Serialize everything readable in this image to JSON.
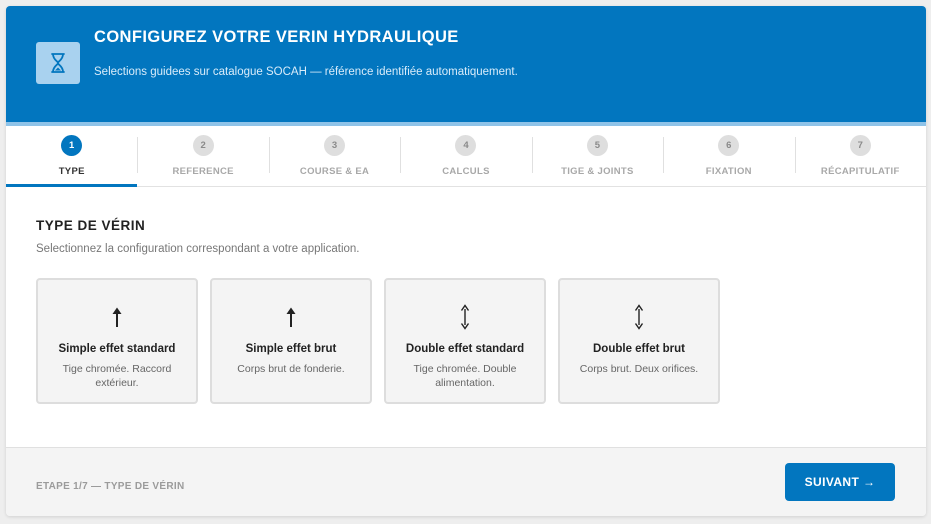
{
  "header": {
    "title": "CONFIGUREZ VOTRE VERIN HYDRAULIQUE",
    "subtitle": "Selections guidees sur catalogue SOCAH — référence identifiée automatiquement.",
    "icon": "hourglass-icon"
  },
  "steps": [
    {
      "num": "1",
      "label": "TYPE",
      "active": true
    },
    {
      "num": "2",
      "label": "REFERENCE",
      "active": false
    },
    {
      "num": "3",
      "label": "COURSE & EA",
      "active": false
    },
    {
      "num": "4",
      "label": "CALCULS",
      "active": false
    },
    {
      "num": "5",
      "label": "TIGE & JOINTS",
      "active": false
    },
    {
      "num": "6",
      "label": "FIXATION",
      "active": false
    },
    {
      "num": "7",
      "label": "RÉCAPITULATIF",
      "active": false
    }
  ],
  "section": {
    "title": "TYPE DE VÉRIN",
    "subtitle": "Selectionnez la configuration correspondant a votre application."
  },
  "options": [
    {
      "icon": "arrow-up-icon",
      "title": "Simple effet standard",
      "desc": "Tige chromée. Raccord extérieur."
    },
    {
      "icon": "arrow-up-icon",
      "title": "Simple effet brut",
      "desc": "Corps brut de fonderie."
    },
    {
      "icon": "arrow-up-down-icon",
      "title": "Double effet standard",
      "desc": "Tige chromée. Double alimentation."
    },
    {
      "icon": "arrow-up-down-icon",
      "title": "Double effet brut",
      "desc": "Corps brut. Deux orifices."
    }
  ],
  "footer": {
    "step_text": "ETAPE 1/7 — TYPE DE VÉRIN",
    "next_label": "SUIVANT →"
  },
  "colors": {
    "primary": "#0276bf",
    "header_accent": "#8fc3e8",
    "icon_bg": "#a9d2ef"
  }
}
